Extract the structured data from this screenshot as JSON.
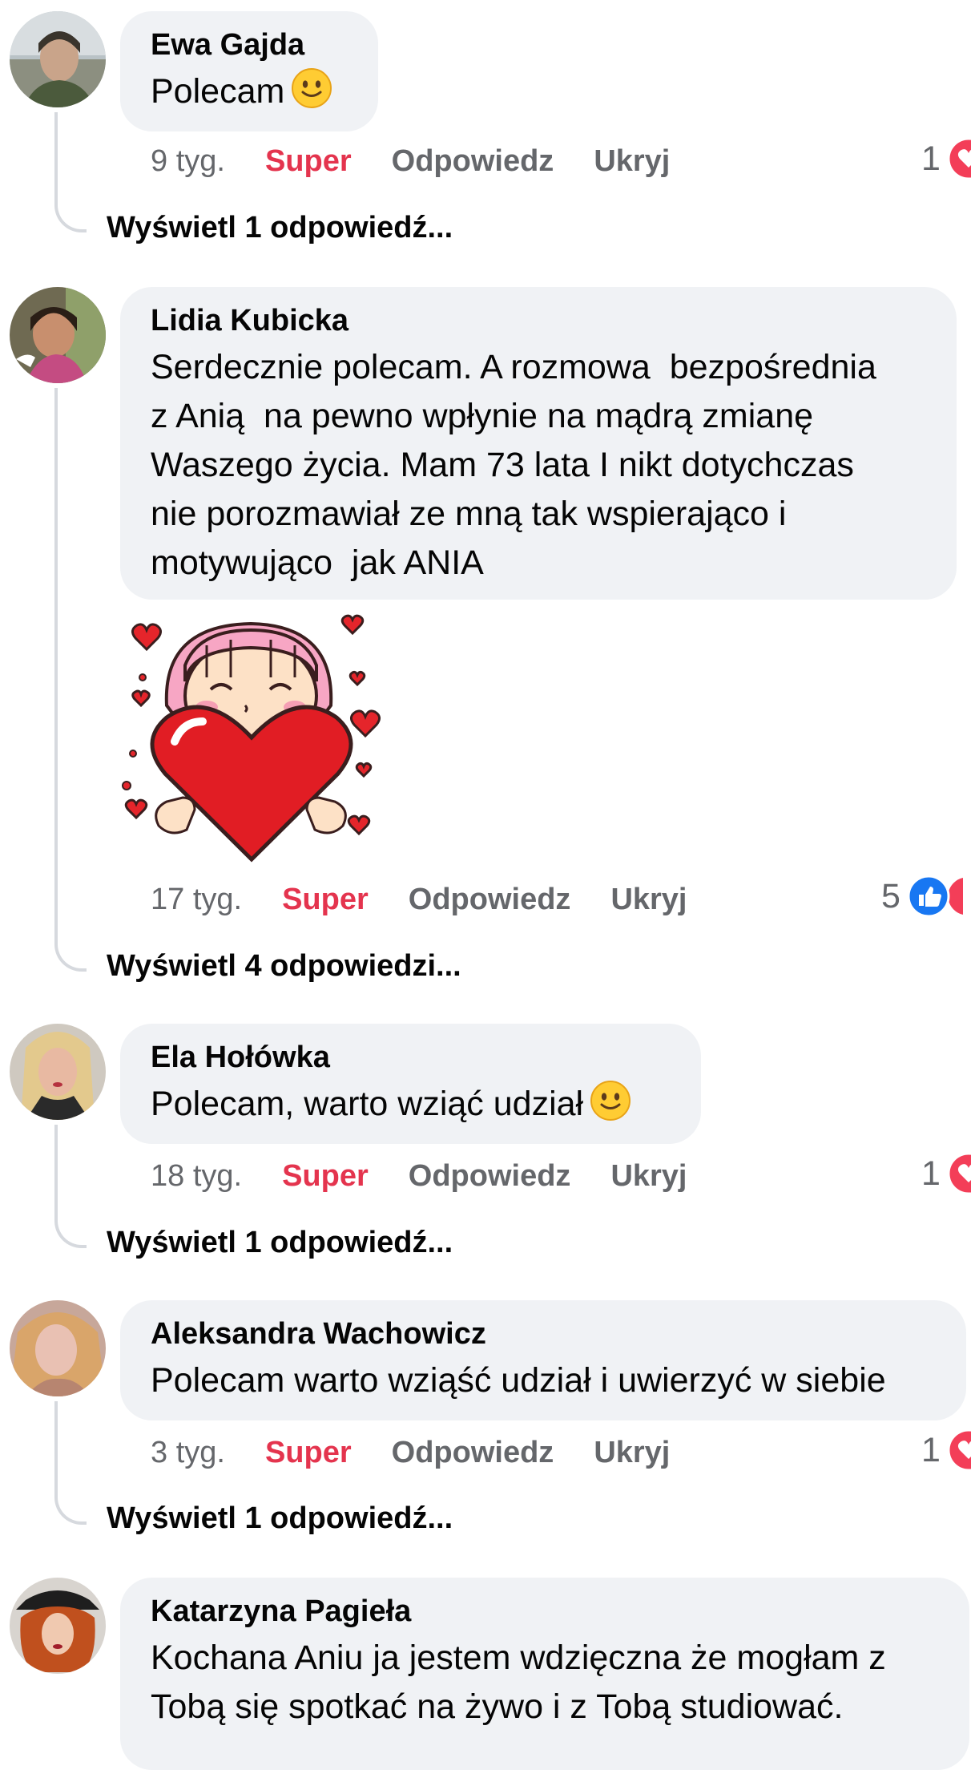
{
  "comments": [
    {
      "author": "Ewa Gajda",
      "text": "Polecam",
      "emoji": "slightly-smiling-face",
      "time": "9 tyg.",
      "like_label": "Super",
      "reply_label": "Odpowiedz",
      "hide_label": "Ukryj",
      "reaction_count": "1",
      "reactions": [
        "love"
      ],
      "view_replies": "Wyświetl 1 odpowiedź..."
    },
    {
      "author": "Lidia Kubicka",
      "text": "Serdecznie polecam. A rozmowa  bezpośrednia\nz Anią  na pewno wpłynie na mądrą zmianę\nWaszego życia. Mam 73 lata I nikt dotychczas\nnie porozmawiał ze mną tak wspierająco i\nmotywująco  jak ANIA",
      "sticker": "girl-hugging-heart-sticker",
      "time": "17 tyg.",
      "like_label": "Super",
      "reply_label": "Odpowiedz",
      "hide_label": "Ukryj",
      "reaction_count": "5",
      "reactions": [
        "like",
        "love"
      ],
      "view_replies": "Wyświetl 4 odpowiedzi..."
    },
    {
      "author": "Ela Hołówka",
      "text": "Polecam, warto wziąć udział",
      "emoji": "slightly-smiling-face",
      "time": "18 tyg.",
      "like_label": "Super",
      "reply_label": "Odpowiedz",
      "hide_label": "Ukryj",
      "reaction_count": "1",
      "reactions": [
        "love"
      ],
      "view_replies": "Wyświetl 1 odpowiedź..."
    },
    {
      "author": "Aleksandra Wachowicz",
      "text": "Polecam warto wziąść udział i uwierzyć w siebie",
      "time": "3 tyg.",
      "like_label": "Super",
      "reply_label": "Odpowiedz",
      "hide_label": "Ukryj",
      "reaction_count": "1",
      "reactions": [
        "love"
      ],
      "view_replies": "Wyświetl 1 odpowiedź..."
    },
    {
      "author": "Katarzyna Pagieła",
      "text": "Kochana Aniu ja jestem wdzięczna że mogłam z\nTobą się spotkać na żywo i z Tobą studiować."
    }
  ],
  "colors": {
    "bubble": "#f0f2f5",
    "super_active": "#e4344e",
    "secondary_text": "#65676b",
    "like_blue": "#1877f2",
    "love_red": "#f33e58"
  }
}
